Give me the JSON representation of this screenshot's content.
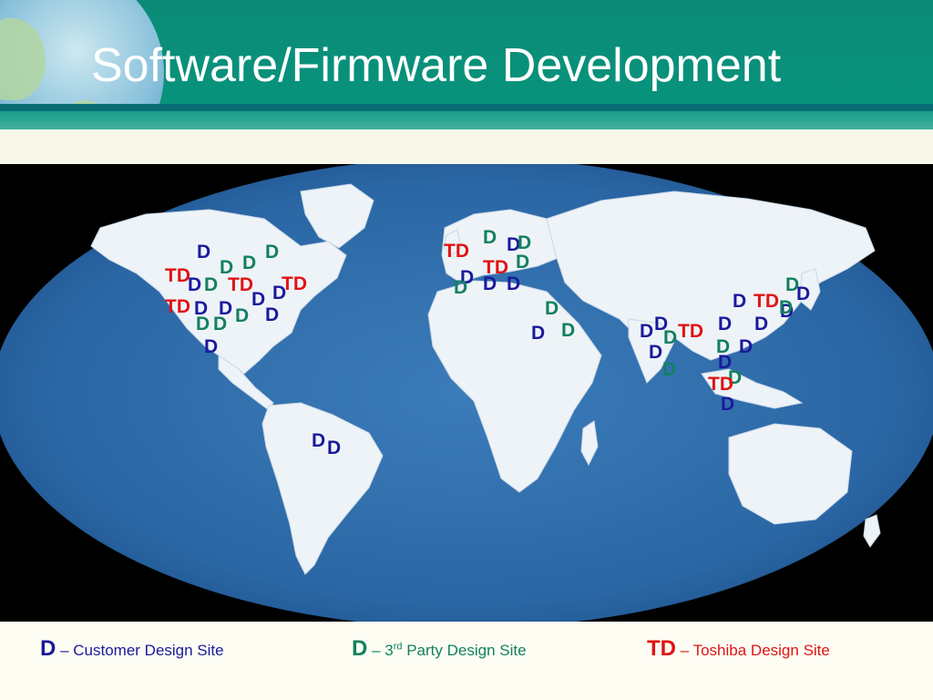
{
  "slide": {
    "title": "Software/Firmware Development"
  },
  "colors": {
    "customer": "#1a1a9c",
    "third_party": "#138060",
    "toshiba": "#e01414",
    "ocean": "#2f6fae",
    "land": "#eef3f8",
    "header": "#08937c"
  },
  "legend": [
    {
      "code": "D",
      "label": "– Customer Design Site",
      "type": "customer"
    },
    {
      "code": "D",
      "label_prefix": "– 3",
      "label_sup": "rd",
      "label_suffix": " Party Design Site",
      "type": "third_party"
    },
    {
      "code": "TD",
      "label": "– Toshiba Design Site",
      "type": "toshiba"
    }
  ],
  "markers": [
    {
      "text": "D",
      "type": "customer"
    },
    {
      "text": "D",
      "type": "third_party"
    },
    {
      "text": "D",
      "type": "third_party"
    },
    {
      "text": "D",
      "type": "third_party"
    },
    {
      "text": "TD",
      "type": "toshiba"
    },
    {
      "text": "D",
      "type": "customer"
    },
    {
      "text": "D",
      "type": "third_party"
    },
    {
      "text": "TD",
      "type": "toshiba"
    },
    {
      "text": "TD",
      "type": "toshiba"
    },
    {
      "text": "D",
      "type": "customer"
    },
    {
      "text": "D",
      "type": "customer"
    },
    {
      "text": "TD",
      "type": "toshiba"
    },
    {
      "text": "D",
      "type": "customer"
    },
    {
      "text": "D",
      "type": "customer"
    },
    {
      "text": "D",
      "type": "third_party"
    },
    {
      "text": "D",
      "type": "customer"
    },
    {
      "text": "D",
      "type": "third_party"
    },
    {
      "text": "D",
      "type": "third_party"
    },
    {
      "text": "D",
      "type": "customer"
    },
    {
      "text": "D",
      "type": "customer"
    },
    {
      "text": "D",
      "type": "customer"
    },
    {
      "text": "D",
      "type": "third_party"
    },
    {
      "text": "TD",
      "type": "toshiba"
    },
    {
      "text": "D",
      "type": "customer"
    },
    {
      "text": "TD",
      "type": "toshiba"
    },
    {
      "text": "D",
      "type": "third_party"
    },
    {
      "text": "D",
      "type": "customer"
    },
    {
      "text": "D",
      "type": "third_party"
    },
    {
      "text": "D",
      "type": "customer"
    },
    {
      "text": "D",
      "type": "customer"
    },
    {
      "text": "D",
      "type": "third_party"
    },
    {
      "text": "D",
      "type": "third_party"
    },
    {
      "text": "D",
      "type": "customer"
    },
    {
      "text": "D",
      "type": "third_party"
    },
    {
      "text": "D",
      "type": "customer"
    },
    {
      "text": "D",
      "type": "customer"
    },
    {
      "text": "D",
      "type": "third_party"
    },
    {
      "text": "TD",
      "type": "toshiba"
    },
    {
      "text": "D",
      "type": "customer"
    },
    {
      "text": "D",
      "type": "third_party"
    },
    {
      "text": "D",
      "type": "customer"
    },
    {
      "text": "D",
      "type": "customer"
    },
    {
      "text": "TD",
      "type": "toshiba"
    },
    {
      "text": "D",
      "type": "customer"
    },
    {
      "text": "D",
      "type": "customer"
    },
    {
      "text": "D",
      "type": "third_party"
    },
    {
      "text": "D",
      "type": "customer"
    },
    {
      "text": "D",
      "type": "customer"
    },
    {
      "text": "D",
      "type": "third_party"
    },
    {
      "text": "TD",
      "type": "toshiba"
    },
    {
      "text": "D",
      "type": "customer"
    },
    {
      "text": "D",
      "type": "third_party"
    },
    {
      "text": "D",
      "type": "customer"
    },
    {
      "text": "D",
      "type": "third_party"
    }
  ]
}
